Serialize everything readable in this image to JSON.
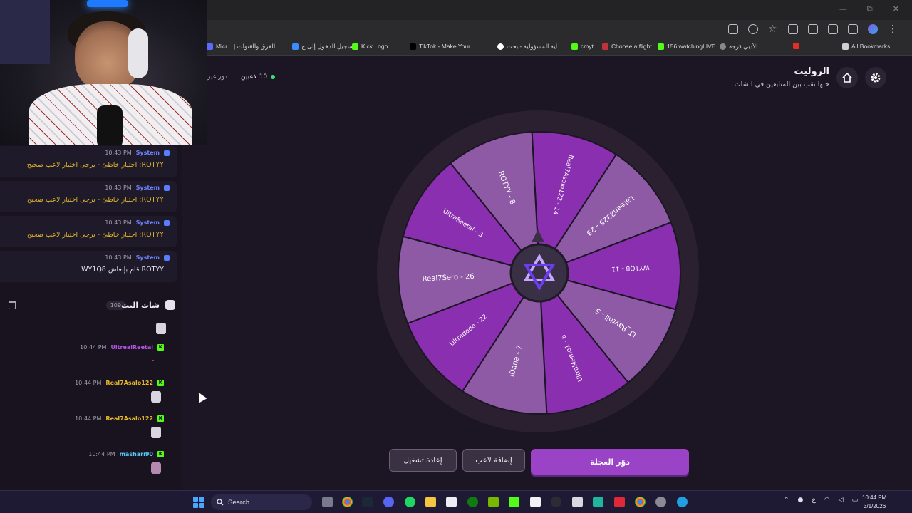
{
  "window": {
    "minimize": "—",
    "restore": "⧉",
    "close": "✕"
  },
  "bookmarks": [
    {
      "label": "Micr... | الفرق والقنوات",
      "icon_color": "#5a6cff"
    },
    {
      "label": "الفرق والقنوات",
      "icon_color": "#e04b2d"
    },
    {
      "label": "تسجيل الدخول إلى ح...",
      "icon_color": "#3c8cff"
    },
    {
      "label": "Kick Logo",
      "icon_color": "#53fc18"
    },
    {
      "label": "TikTok - Make Your...",
      "icon_color": "#111111"
    },
    {
      "label": "اية المسؤولية - بحث...",
      "icon_color": "#ffffff"
    },
    {
      "label": "cmyt",
      "icon_color": "#53fc18"
    },
    {
      "label": "Choose a flight",
      "icon_color": "#c0333a"
    },
    {
      "label": "156 watchingLIVE",
      "icon_color": "#53fc18"
    },
    {
      "label": "الأدبي دَرَجة ...",
      "icon_color": "#888888"
    },
    {
      "label": "All Bookmarks",
      "icon_color": "#cfcfd4"
    }
  ],
  "header": {
    "title": "الروليت",
    "subtitle": "خلها تقب بين المتابعين في الشات",
    "players_count": "10 لاعبين",
    "turn_label": "دور غير"
  },
  "chat": {
    "system_messages": [
      {
        "time": "10:43 PM",
        "name": "System",
        "text": "ROTYY: اختيار خاطئ - يرجى اختيار لاعب صحيح"
      },
      {
        "time": "10:43 PM",
        "name": "System",
        "text": "ROTYY: اختيار خاطئ - يرجى اختيار لاعب صحيح"
      },
      {
        "time": "10:43 PM",
        "name": "System",
        "text": "ROTYY: اختيار خاطئ - يرجى اختيار لاعب صحيح"
      },
      {
        "time": "10:43 PM",
        "name": "System",
        "text": "ROTYY قام بإنعاش WY1Q8"
      }
    ],
    "title": "شات البث",
    "count": "109",
    "messages": [
      {
        "time": "10:44 PM",
        "name": "UltrealReetal",
        "color": "#b455e8"
      },
      {
        "time": "10:44 PM",
        "name": "Real7Asalo122",
        "color": "#e6b72a"
      },
      {
        "time": "10:44 PM",
        "name": "Real7Asalo122",
        "color": "#e6b72a"
      },
      {
        "time": "10:44 PM",
        "name": "mashari90",
        "color": "#5ac8ff"
      }
    ],
    "kick_badge": "K"
  },
  "wheel": {
    "segments": [
      {
        "label": "Real7Asalo122 - 14",
        "color": "#8a2fb0"
      },
      {
        "label": "Lateen2325 - 23",
        "color": "#8e5aa6"
      },
      {
        "label": "WY1Q8 - 11",
        "color": "#8a2fb0"
      },
      {
        "label": "LT_Raythil - 5",
        "color": "#8e5aa6"
      },
      {
        "label": "UltraMeme1 - 6",
        "color": "#8a2fb0"
      },
      {
        "label": "iDana - 7",
        "color": "#8e5aa6"
      },
      {
        "label": "Ultradodo - 22",
        "color": "#8a2fb0"
      },
      {
        "label": "Real7Sero - 26",
        "color": "#8e5aa6"
      },
      {
        "label": "UltraReetal - 3",
        "color": "#8a2fb0"
      },
      {
        "label": "ROTYY - 8",
        "color": "#8e5aa6"
      }
    ],
    "rim_color": "#2a2030",
    "hub_color": "#3a3046"
  },
  "buttons": {
    "spin": "دوّر العجلة",
    "add_player": "إضافة لاعب",
    "reset": "إعادة تشغيل"
  },
  "taskbar": {
    "search": "Search",
    "time": "10:44 PM",
    "date": "3/1/2026",
    "lang": "ع"
  }
}
